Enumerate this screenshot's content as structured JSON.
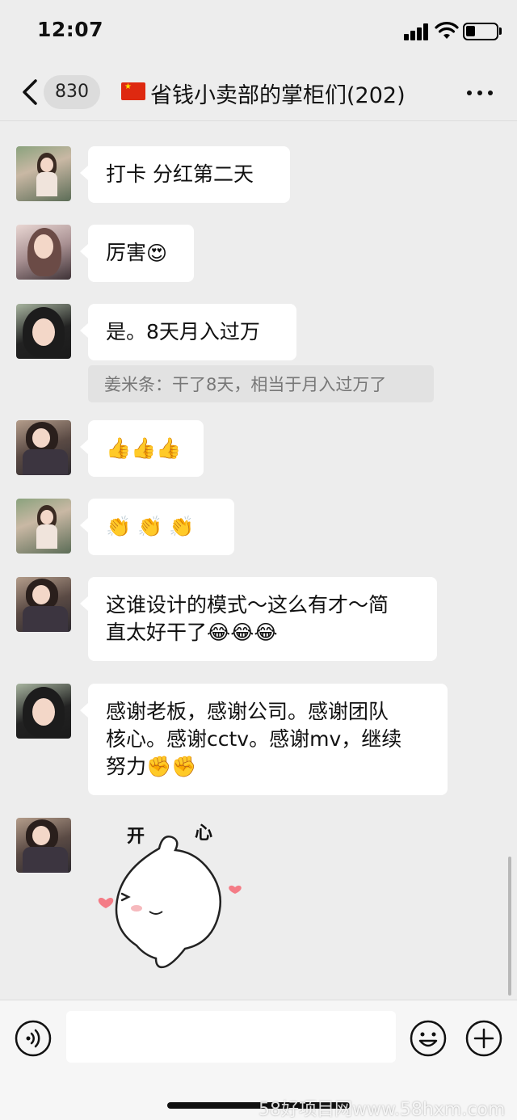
{
  "status_bar": {
    "time": "12:07",
    "battery_level": 0.3
  },
  "header": {
    "unread_count": "830",
    "title": "省钱小卖部的掌柜们(202)"
  },
  "messages": [
    {
      "text": "打卡 分红第二天"
    },
    {
      "text": "厉害",
      "emoji": "😍"
    },
    {
      "text": "是。8天月入过万",
      "quote": "姜米条：干了8天，相当于月入过万了"
    },
    {
      "emoji_only": "👍👍👍"
    },
    {
      "emoji_only": "👏 👏 👏"
    },
    {
      "line1": "这谁设计的模式～这么有才～简",
      "line2": "直太好干了😂😂😂"
    },
    {
      "line1": "感谢老板，感谢公司。感谢团队",
      "line2": "核心。感谢cctv。感谢mv，继续",
      "line3": "努力✊✊"
    },
    {
      "sticker_text_1": "开",
      "sticker_text_2": "心"
    }
  ],
  "watermark": "58好项目网www.58hxm.com",
  "icons": {
    "back": "chevron-left-icon",
    "flag": "china-flag-icon",
    "more": "more-dots-icon",
    "voice": "voice-icon",
    "emoji": "emoji-icon",
    "plus": "plus-icon"
  }
}
